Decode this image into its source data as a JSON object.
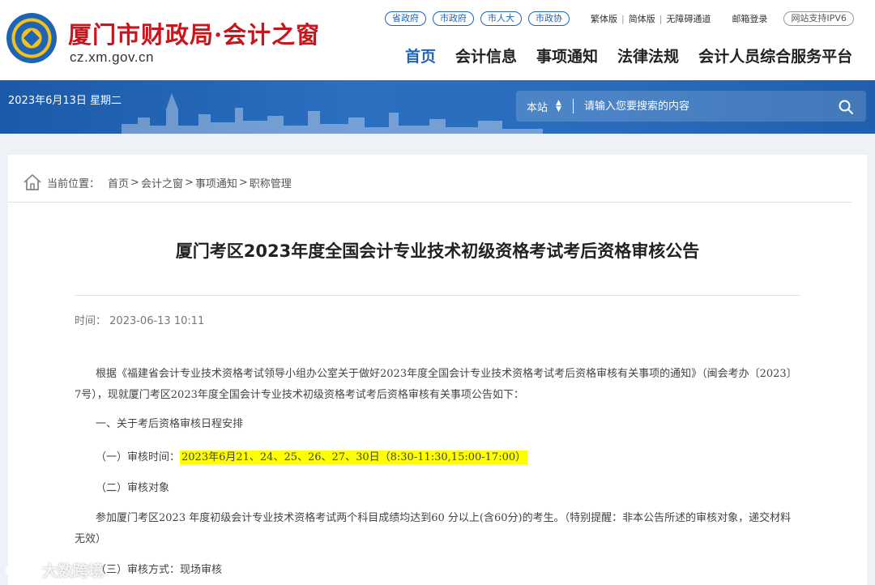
{
  "header": {
    "site_title": "厦门市财政局·会计之窗",
    "site_url": "cz.xm.gov.cn",
    "top_pills": [
      "省政府",
      "市政府",
      "市人大",
      "市政协"
    ],
    "top_links": [
      "繁体版",
      "简体版",
      "无障碍通道",
      "邮箱登录"
    ],
    "ipv6_badge": "网站支持IPV6",
    "nav": [
      "首页",
      "会计信息",
      "事项通知",
      "法律法规",
      "会计人员综合服务平台"
    ]
  },
  "banner": {
    "date": "2023年6月13日 星期二",
    "search_scope": "本站",
    "search_placeholder": "请输入您要搜索的内容"
  },
  "breadcrumb": {
    "label": "当前位置：",
    "items": [
      "首页",
      "会计之窗",
      "事项通知",
      "职称管理"
    ]
  },
  "article": {
    "title": "厦门考区2023年度全国会计专业技术初级资格考试考后资格审核公告",
    "time_label": "时间：",
    "time_value": "2023-06-13 10:11",
    "para1": "根据《福建省会计专业技术资格考试领导小组办公室关于做好2023年度全国会计专业技术资格考试考后资格审核有关事项的通知》（闽会考办〔2023〕7号），现就厦门考区2023年度全国会计专业技术初级资格考试考后资格审核有关事项公告如下：",
    "heading1": "一、关于考后资格审核日程安排",
    "item1_label": "（一）审核时间：",
    "item1_value": "2023年6月21、24、25、26、27、30日（8:30-11:30,15:00-17:00）",
    "item2": "（二）审核对象",
    "para2": "参加厦门考区2023 年度初级会计专业技术资格考试两个科目成绩均达到60 分以上(含60分)的考生。（特别提醒：非本公告所述的审核对象，递交材料无效）",
    "item3": "（三）审核方式：现场审核"
  },
  "watermark": {
    "text": "大数跨境"
  },
  "colors": {
    "brand_blue": "#1d63b6",
    "brand_red": "#c8161d",
    "highlight": "#ffff00"
  }
}
